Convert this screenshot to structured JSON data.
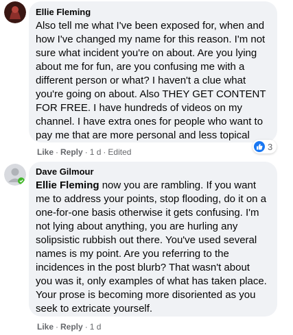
{
  "comments": [
    {
      "author": "Ellie Fleming",
      "text": "Also tell me what I've been exposed for, when and how I've changed my name for this reason. I'm not sure what incident you're on about. Are you lying about me for fun, are you confusing me with a different person or what? I haven't a clue what you're going on about. Also THEY GET CONTENT FOR FREE. I have hundreds of videos on my channel. I have extra ones for people who want to pay me that are more personal and less topical",
      "actions": {
        "like": "Like",
        "reply": "Reply",
        "time": "1 d",
        "edited": "Edited"
      },
      "reaction_count": "3",
      "avatar_color": "#7a2d27"
    },
    {
      "author": "Dave Gilmour",
      "mention": "Ellie Fleming",
      "text": " now you are rambling. If you want me to address your points, stop flooding, do it on a one-for-one basis otherwise it gets confusing. I'm not lying about anything, you are hurling any solipsistic rubbish out there. You've used several names is my point. Are you referring to the incidences in the post blurb? That wasn't about you was it, only examples of what has taken place. Your prose is becoming more disoriented as you seek to extricate yourself.",
      "actions": {
        "like": "Like",
        "reply": "Reply",
        "time": "1 d"
      },
      "avatar_color": "#c9ccd1"
    }
  ],
  "colors": {
    "bubble_bg": "#f0f2f5",
    "meta_text": "#65676b",
    "like_blue": "#1877f2"
  }
}
